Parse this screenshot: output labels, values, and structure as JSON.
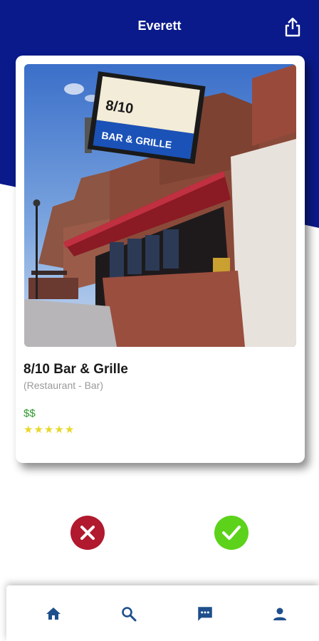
{
  "header": {
    "title": "Everett",
    "share_icon": "share-icon",
    "background_color": "#0a1a8a"
  },
  "listing": {
    "name": "8/10 Bar & Grille",
    "category": "(Restaurant - Bar)",
    "price": "$$",
    "rating": 5,
    "rating_max": 5,
    "photo": {
      "sign_top_text": "8/10",
      "sign_bottom_text": "BAR & GRILLE"
    }
  },
  "actions": {
    "reject_icon": "close-icon",
    "reject_color": "#b0192e",
    "accept_icon": "check-icon",
    "accept_color": "#5cd21a"
  },
  "nav": {
    "items": [
      {
        "icon": "home-icon"
      },
      {
        "icon": "search-icon"
      },
      {
        "icon": "chat-icon"
      },
      {
        "icon": "profile-icon"
      }
    ],
    "icon_color": "#1e4f8c"
  }
}
